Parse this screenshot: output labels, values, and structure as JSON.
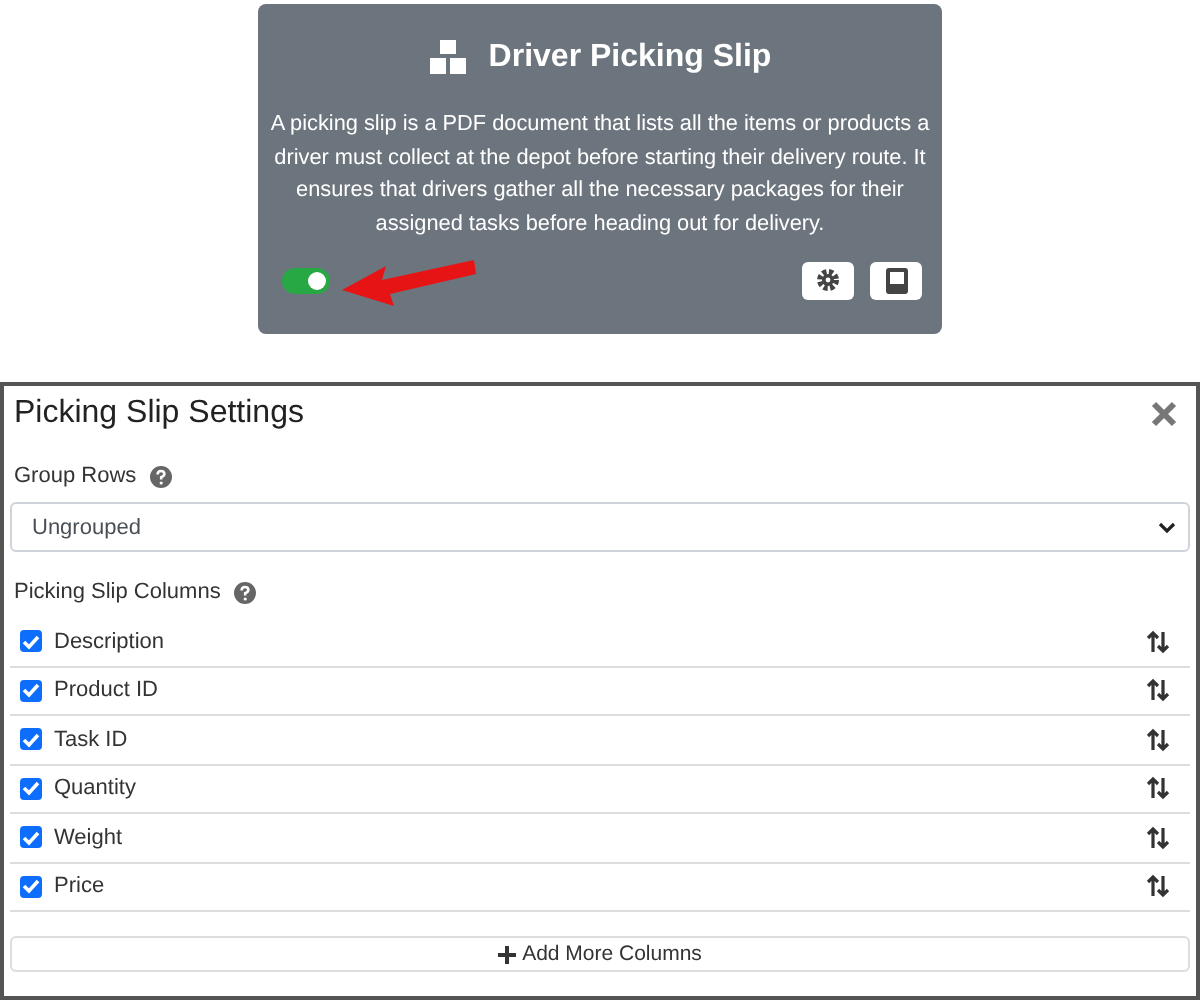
{
  "card": {
    "title": "Driver Picking Slip",
    "description": "A picking slip is a PDF document that lists all the items or products a driver must collect at the depot before starting their delivery route. It ensures that drivers gather all the necessary packages for their assigned tasks before heading out for delivery.",
    "enabled": true
  },
  "modal": {
    "title": "Picking Slip Settings",
    "group_rows": {
      "label": "Group Rows",
      "value": "Ungrouped"
    },
    "columns_label": "Picking Slip Columns",
    "columns": [
      {
        "label": "Description",
        "checked": true
      },
      {
        "label": "Product ID",
        "checked": true
      },
      {
        "label": "Task ID",
        "checked": true
      },
      {
        "label": "Quantity",
        "checked": true
      },
      {
        "label": "Weight",
        "checked": true
      },
      {
        "label": "Price",
        "checked": true
      }
    ],
    "add_button": "Add More Columns"
  }
}
